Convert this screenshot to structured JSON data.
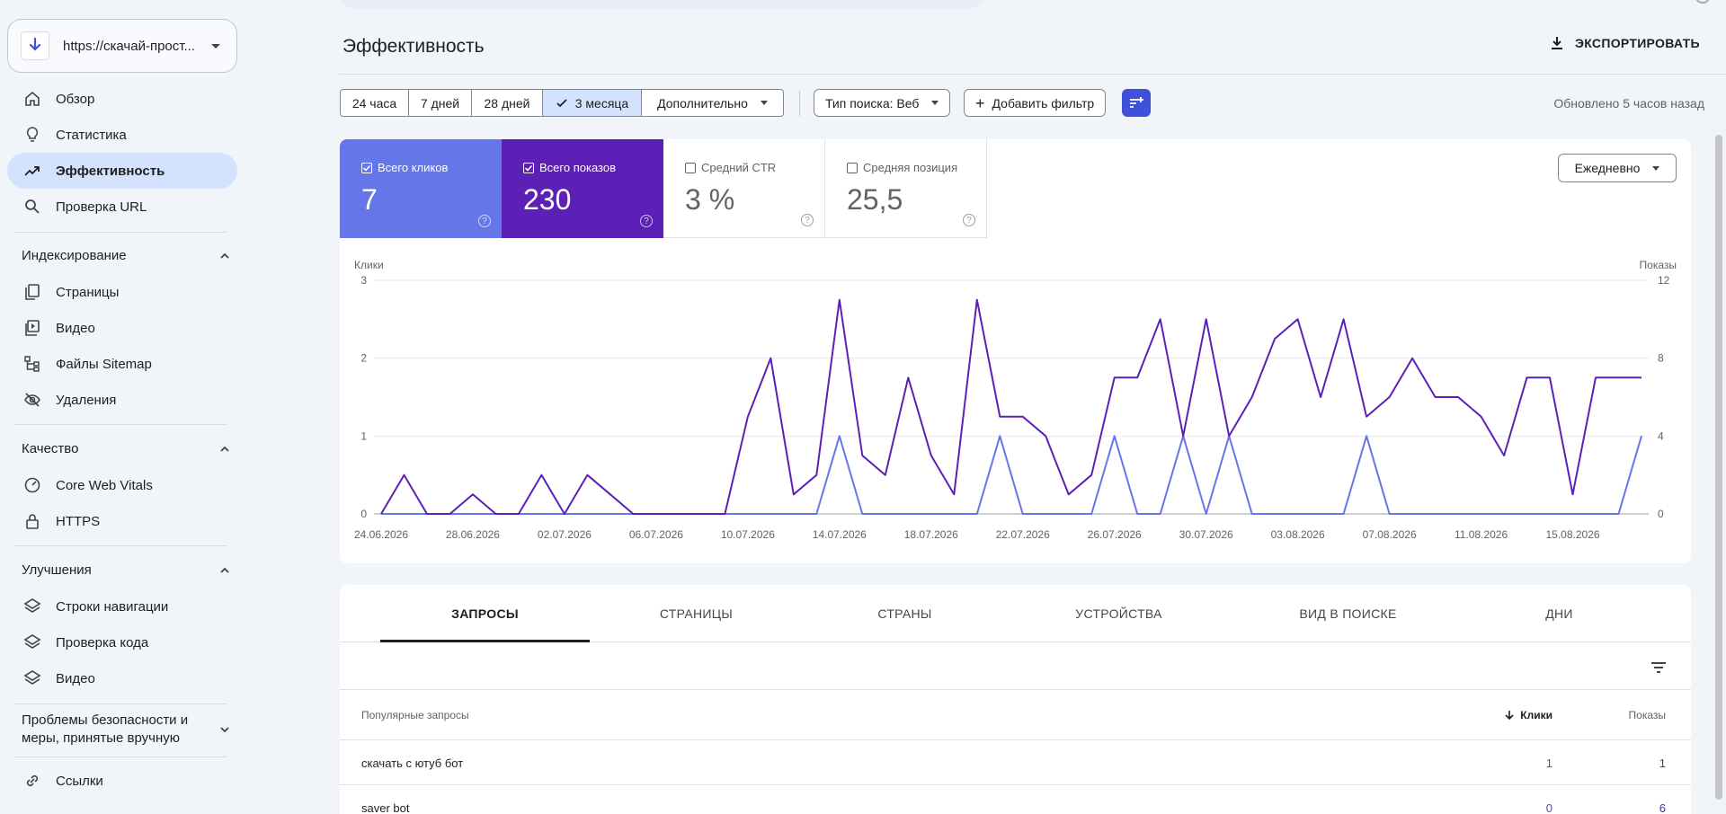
{
  "property": {
    "url": "https://скачай-прост..."
  },
  "nav": {
    "overview": "Обзор",
    "stats": "Статистика",
    "performance": "Эффективность",
    "url_check": "Проверка URL",
    "indexing": "Индексирование",
    "pages": "Страницы",
    "video": "Видео",
    "sitemaps": "Файлы Sitemap",
    "removals": "Удаления",
    "quality": "Качество",
    "cwv": "Core Web Vitals",
    "https": "HTTPS",
    "enhancements": "Улучшения",
    "breadcrumbs": "Строки навигации",
    "code_check": "Проверка кода",
    "video2": "Видео",
    "security_line1": "Проблемы безопасности и",
    "security_line2": "меры, принятые вручную",
    "links": "Ссылки"
  },
  "header": {
    "title": "Эффективность",
    "export": "ЭКСПОРТИРОВАТЬ"
  },
  "filters": {
    "d24h": "24 часа",
    "d7": "7 дней",
    "d28": "28 дней",
    "d3m": "3 месяца",
    "more": "Дополнительно",
    "search_type": "Тип поиска: Веб",
    "add_filter": "Добавить фильтр",
    "updated": "Обновлено 5 часов назад"
  },
  "metrics": {
    "clicks": {
      "label": "Всего кликов",
      "value": "7"
    },
    "impressions": {
      "label": "Всего показов",
      "value": "230"
    },
    "ctr": {
      "label": "Средний CTR",
      "value": "3 %"
    },
    "position": {
      "label": "Средняя позиция",
      "value": "25,5"
    }
  },
  "granularity": "Ежедневно",
  "colors": {
    "clicks": "#6576e8",
    "impressions": "#5c20b7",
    "accent": "#3f51d8"
  },
  "chart_data": {
    "type": "line",
    "ylabel_left": "Клики",
    "ylabel_right": "Показы",
    "y_left_ticks": [
      "0",
      "1",
      "2",
      "3"
    ],
    "y_right_ticks": [
      "0",
      "4",
      "8",
      "12"
    ],
    "ylim_left": [
      0,
      3
    ],
    "ylim_right": [
      0,
      12
    ],
    "x_tick_labels": [
      "24.06.2026",
      "28.06.2026",
      "02.07.2026",
      "06.07.2026",
      "10.07.2026",
      "14.07.2026",
      "18.07.2026",
      "22.07.2026",
      "26.07.2026",
      "30.07.2026",
      "03.08.2026",
      "07.08.2026",
      "11.08.2026",
      "15.08.2026"
    ],
    "x_tick_index": [
      0,
      4,
      8,
      12,
      16,
      20,
      24,
      28,
      32,
      36,
      40,
      44,
      48,
      52
    ],
    "grid": true,
    "series": [
      {
        "name": "Всего кликов",
        "axis": "left",
        "values": [
          0,
          0,
          0,
          0,
          0,
          0,
          0,
          0,
          0,
          0,
          0,
          0,
          0,
          0,
          0,
          0,
          0,
          0,
          0,
          0,
          1,
          0,
          0,
          0,
          0,
          0,
          0,
          1,
          0,
          0,
          0,
          0,
          1,
          0,
          0,
          1,
          0,
          1,
          0,
          0,
          0,
          0,
          0,
          1,
          0,
          0,
          0,
          0,
          0,
          0,
          0,
          0,
          0,
          0,
          0,
          1
        ]
      },
      {
        "name": "Всего показов",
        "axis": "right",
        "values": [
          0,
          2,
          0,
          0,
          1,
          0,
          0,
          2,
          0,
          2,
          1,
          0,
          0,
          0,
          0,
          0,
          5,
          8,
          1,
          2,
          11,
          3,
          2,
          7,
          3,
          1,
          11,
          5,
          5,
          4,
          1,
          2,
          7,
          7,
          10,
          4,
          10,
          4,
          6,
          9,
          10,
          6,
          10,
          5,
          6,
          8,
          6,
          6,
          5,
          3,
          7,
          7,
          1,
          7,
          7,
          7
        ]
      }
    ]
  },
  "tabs": [
    "ЗАПРОСЫ",
    "СТРАНИЦЫ",
    "СТРАНЫ",
    "УСТРОЙСТВА",
    "ВИД В ПОИСКЕ",
    "ДНИ"
  ],
  "table": {
    "headers": {
      "query": "Популярные запросы",
      "clicks": "Клики",
      "impressions": "Показы"
    },
    "rows": [
      {
        "query": "скачать с ютуб бот",
        "clicks": "1",
        "impressions": "1"
      },
      {
        "query": "saver bot",
        "clicks": "0",
        "impressions": "6"
      }
    ]
  }
}
